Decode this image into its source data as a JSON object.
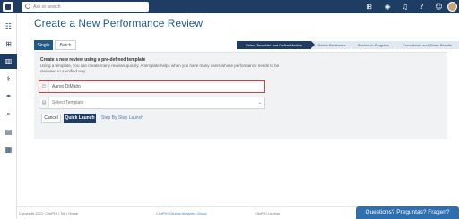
{
  "header": {
    "search_placeholder": "Ask or search",
    "icons": [
      "grid-icon",
      "box-icon",
      "bell-icon",
      "help-icon",
      "user-icon"
    ]
  },
  "sidebar": {
    "items": [
      {
        "icon": "users-icon",
        "glyph": "👥",
        "active": false
      },
      {
        "icon": "diagram-icon",
        "glyph": "⊞",
        "active": false
      },
      {
        "icon": "bar-chart-icon",
        "glyph": "▥",
        "active": true
      },
      {
        "icon": "pill-icon",
        "glyph": "⚕",
        "active": false
      },
      {
        "icon": "network-icon",
        "glyph": "⚭",
        "active": false
      },
      {
        "icon": "search-icon",
        "glyph": "⌕",
        "active": false
      },
      {
        "icon": "document-icon",
        "glyph": "▤",
        "active": false
      },
      {
        "icon": "table-icon",
        "glyph": "▦",
        "active": false
      }
    ]
  },
  "page": {
    "title": "Create a New Performance Review"
  },
  "tabs": {
    "single": "Single",
    "batch": "Batch"
  },
  "steps": [
    {
      "label": "Select Template and Define Metrics",
      "active": true
    },
    {
      "label": "Select Reviewers",
      "active": false
    },
    {
      "label": "Review in Progress",
      "active": false
    },
    {
      "label": "Consolidate and Share Results",
      "active": false
    }
  ],
  "form": {
    "heading": "Create a new review using a pre-defined template",
    "description": "Using a template, you can create many reviews quickly. A template helps when you have many users whose performance needs to be reviewed in a unified way.",
    "user_value": "Aaron DiMatto",
    "template_placeholder": "Select Template",
    "cancel_label": "Cancel",
    "quick_launch_label": "Quick Launch",
    "step_by_step_label": "Step By Step Launch"
  },
  "footer": {
    "left": "Copyright 2021, ClinPHI | Toll | Home",
    "middle": "ClinPHI Clinical Analytics Group",
    "right": "ClinPHI License"
  },
  "help_bar": "Questions? Preguntas? Fragen?"
}
